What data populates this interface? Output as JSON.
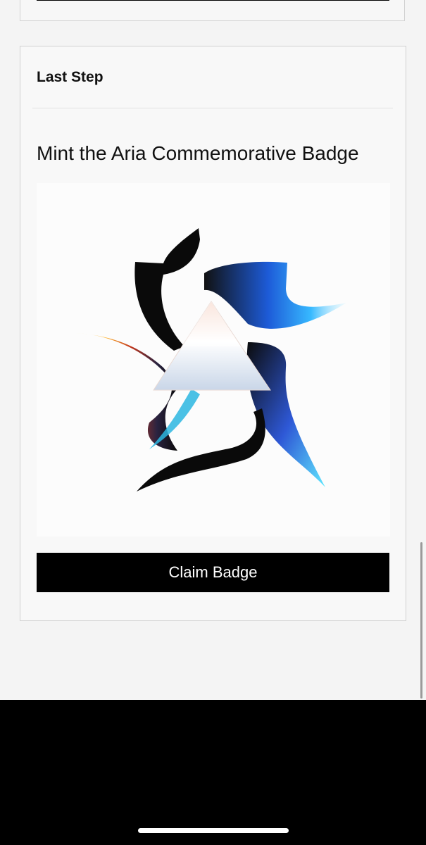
{
  "card": {
    "title": "Last Step",
    "headline": "Mint the Aria Commemorative Badge",
    "claim_button_label": "Claim Badge"
  },
  "badge_image": {
    "icon": "aria-star-prism-badge"
  },
  "colors": {
    "page_background": "#f4f4f4",
    "card_background": "#f8f8f8",
    "button_background": "#000000",
    "button_text": "#ffffff",
    "bottom_panel": "#000000"
  }
}
